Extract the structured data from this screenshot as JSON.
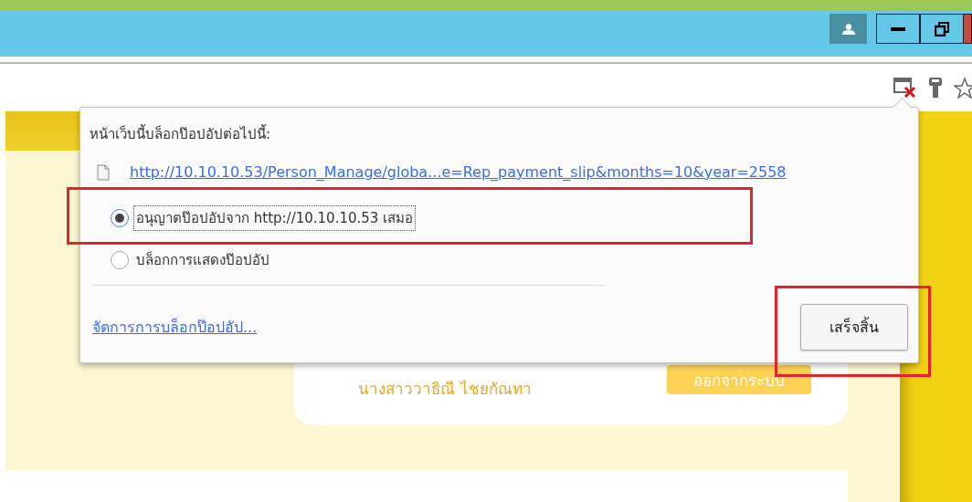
{
  "popup": {
    "title": "หน้าเว็บนี้บล็อกป๊อปอัปต่อไปนี้:",
    "blocked_url": "http://10.10.10.53/Person_Manage/globa...e=Rep_payment_slip&months=10&year=2558",
    "options": [
      {
        "label": "อนุญาตป๊อปอัปจาก http://10.10.10.53 เสมอ",
        "selected": true
      },
      {
        "label": "บล็อกการแสดงป๊อปอัป",
        "selected": false
      }
    ],
    "manage_link": "จัดการการบล็อกป๊อปอัป...",
    "done_button": "เสร็จสิ้น"
  },
  "page": {
    "user_name": "นางสาววาธิณี ไชยกัณทา",
    "logout_button": "ออกจากระบบ"
  }
}
